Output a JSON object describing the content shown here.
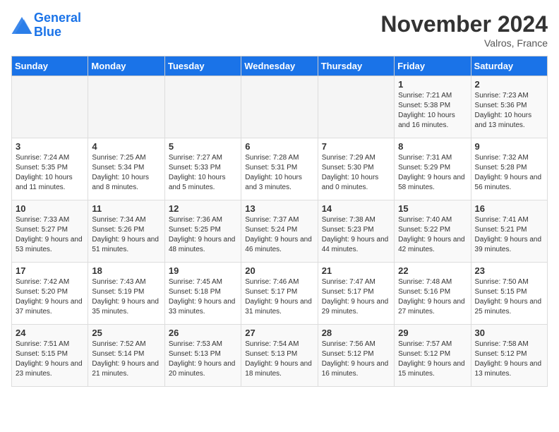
{
  "header": {
    "logo_line1": "General",
    "logo_line2": "Blue",
    "month": "November 2024",
    "location": "Valros, France"
  },
  "weekdays": [
    "Sunday",
    "Monday",
    "Tuesday",
    "Wednesday",
    "Thursday",
    "Friday",
    "Saturday"
  ],
  "weeks": [
    [
      {
        "day": "",
        "sunrise": "",
        "sunset": "",
        "daylight": ""
      },
      {
        "day": "",
        "sunrise": "",
        "sunset": "",
        "daylight": ""
      },
      {
        "day": "",
        "sunrise": "",
        "sunset": "",
        "daylight": ""
      },
      {
        "day": "",
        "sunrise": "",
        "sunset": "",
        "daylight": ""
      },
      {
        "day": "",
        "sunrise": "",
        "sunset": "",
        "daylight": ""
      },
      {
        "day": "1",
        "sunrise": "Sunrise: 7:21 AM",
        "sunset": "Sunset: 5:38 PM",
        "daylight": "Daylight: 10 hours and 16 minutes."
      },
      {
        "day": "2",
        "sunrise": "Sunrise: 7:23 AM",
        "sunset": "Sunset: 5:36 PM",
        "daylight": "Daylight: 10 hours and 13 minutes."
      }
    ],
    [
      {
        "day": "3",
        "sunrise": "Sunrise: 7:24 AM",
        "sunset": "Sunset: 5:35 PM",
        "daylight": "Daylight: 10 hours and 11 minutes."
      },
      {
        "day": "4",
        "sunrise": "Sunrise: 7:25 AM",
        "sunset": "Sunset: 5:34 PM",
        "daylight": "Daylight: 10 hours and 8 minutes."
      },
      {
        "day": "5",
        "sunrise": "Sunrise: 7:27 AM",
        "sunset": "Sunset: 5:33 PM",
        "daylight": "Daylight: 10 hours and 5 minutes."
      },
      {
        "day": "6",
        "sunrise": "Sunrise: 7:28 AM",
        "sunset": "Sunset: 5:31 PM",
        "daylight": "Daylight: 10 hours and 3 minutes."
      },
      {
        "day": "7",
        "sunrise": "Sunrise: 7:29 AM",
        "sunset": "Sunset: 5:30 PM",
        "daylight": "Daylight: 10 hours and 0 minutes."
      },
      {
        "day": "8",
        "sunrise": "Sunrise: 7:31 AM",
        "sunset": "Sunset: 5:29 PM",
        "daylight": "Daylight: 9 hours and 58 minutes."
      },
      {
        "day": "9",
        "sunrise": "Sunrise: 7:32 AM",
        "sunset": "Sunset: 5:28 PM",
        "daylight": "Daylight: 9 hours and 56 minutes."
      }
    ],
    [
      {
        "day": "10",
        "sunrise": "Sunrise: 7:33 AM",
        "sunset": "Sunset: 5:27 PM",
        "daylight": "Daylight: 9 hours and 53 minutes."
      },
      {
        "day": "11",
        "sunrise": "Sunrise: 7:34 AM",
        "sunset": "Sunset: 5:26 PM",
        "daylight": "Daylight: 9 hours and 51 minutes."
      },
      {
        "day": "12",
        "sunrise": "Sunrise: 7:36 AM",
        "sunset": "Sunset: 5:25 PM",
        "daylight": "Daylight: 9 hours and 48 minutes."
      },
      {
        "day": "13",
        "sunrise": "Sunrise: 7:37 AM",
        "sunset": "Sunset: 5:24 PM",
        "daylight": "Daylight: 9 hours and 46 minutes."
      },
      {
        "day": "14",
        "sunrise": "Sunrise: 7:38 AM",
        "sunset": "Sunset: 5:23 PM",
        "daylight": "Daylight: 9 hours and 44 minutes."
      },
      {
        "day": "15",
        "sunrise": "Sunrise: 7:40 AM",
        "sunset": "Sunset: 5:22 PM",
        "daylight": "Daylight: 9 hours and 42 minutes."
      },
      {
        "day": "16",
        "sunrise": "Sunrise: 7:41 AM",
        "sunset": "Sunset: 5:21 PM",
        "daylight": "Daylight: 9 hours and 39 minutes."
      }
    ],
    [
      {
        "day": "17",
        "sunrise": "Sunrise: 7:42 AM",
        "sunset": "Sunset: 5:20 PM",
        "daylight": "Daylight: 9 hours and 37 minutes."
      },
      {
        "day": "18",
        "sunrise": "Sunrise: 7:43 AM",
        "sunset": "Sunset: 5:19 PM",
        "daylight": "Daylight: 9 hours and 35 minutes."
      },
      {
        "day": "19",
        "sunrise": "Sunrise: 7:45 AM",
        "sunset": "Sunset: 5:18 PM",
        "daylight": "Daylight: 9 hours and 33 minutes."
      },
      {
        "day": "20",
        "sunrise": "Sunrise: 7:46 AM",
        "sunset": "Sunset: 5:17 PM",
        "daylight": "Daylight: 9 hours and 31 minutes."
      },
      {
        "day": "21",
        "sunrise": "Sunrise: 7:47 AM",
        "sunset": "Sunset: 5:17 PM",
        "daylight": "Daylight: 9 hours and 29 minutes."
      },
      {
        "day": "22",
        "sunrise": "Sunrise: 7:48 AM",
        "sunset": "Sunset: 5:16 PM",
        "daylight": "Daylight: 9 hours and 27 minutes."
      },
      {
        "day": "23",
        "sunrise": "Sunrise: 7:50 AM",
        "sunset": "Sunset: 5:15 PM",
        "daylight": "Daylight: 9 hours and 25 minutes."
      }
    ],
    [
      {
        "day": "24",
        "sunrise": "Sunrise: 7:51 AM",
        "sunset": "Sunset: 5:15 PM",
        "daylight": "Daylight: 9 hours and 23 minutes."
      },
      {
        "day": "25",
        "sunrise": "Sunrise: 7:52 AM",
        "sunset": "Sunset: 5:14 PM",
        "daylight": "Daylight: 9 hours and 21 minutes."
      },
      {
        "day": "26",
        "sunrise": "Sunrise: 7:53 AM",
        "sunset": "Sunset: 5:13 PM",
        "daylight": "Daylight: 9 hours and 20 minutes."
      },
      {
        "day": "27",
        "sunrise": "Sunrise: 7:54 AM",
        "sunset": "Sunset: 5:13 PM",
        "daylight": "Daylight: 9 hours and 18 minutes."
      },
      {
        "day": "28",
        "sunrise": "Sunrise: 7:56 AM",
        "sunset": "Sunset: 5:12 PM",
        "daylight": "Daylight: 9 hours and 16 minutes."
      },
      {
        "day": "29",
        "sunrise": "Sunrise: 7:57 AM",
        "sunset": "Sunset: 5:12 PM",
        "daylight": "Daylight: 9 hours and 15 minutes."
      },
      {
        "day": "30",
        "sunrise": "Sunrise: 7:58 AM",
        "sunset": "Sunset: 5:12 PM",
        "daylight": "Daylight: 9 hours and 13 minutes."
      }
    ]
  ]
}
